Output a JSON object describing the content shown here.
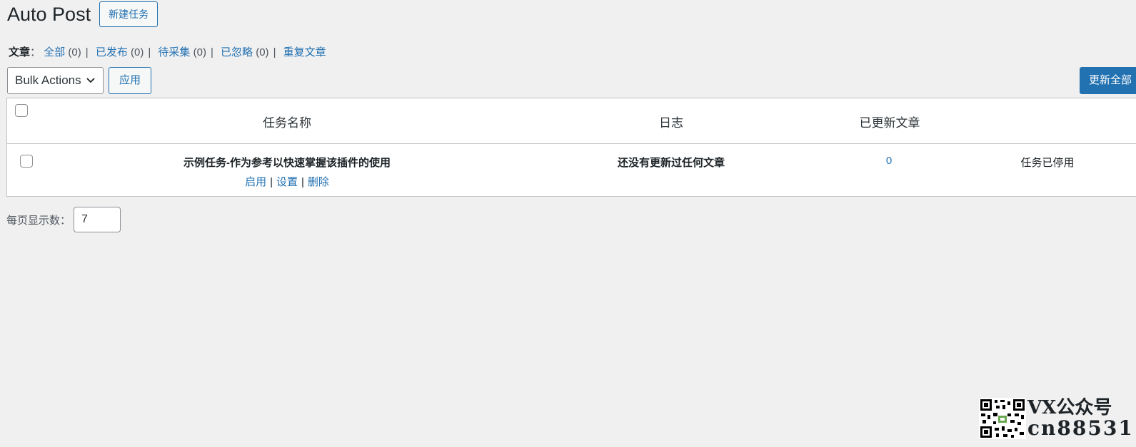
{
  "header": {
    "title": "Auto Post",
    "new_task_label": "新建任务"
  },
  "filters": {
    "label": "文章",
    "colon": "：",
    "items": [
      {
        "label": "全部",
        "count": "(0)"
      },
      {
        "label": "已发布",
        "count": "(0)"
      },
      {
        "label": "待采集",
        "count": "(0)"
      },
      {
        "label": "已忽略",
        "count": "(0)"
      },
      {
        "label": "重复文章",
        "count": ""
      }
    ],
    "separator": "|"
  },
  "tablenav": {
    "bulk_actions": "Bulk Actions",
    "apply_label": "应用",
    "update_all_label": "更新全部"
  },
  "table": {
    "columns": [
      "任务名称",
      "日志",
      "已更新文章"
    ],
    "rows": [
      {
        "name": "示例任务-作为参考以快速掌握该插件的使用",
        "actions": [
          "启用",
          "设置",
          "删除"
        ],
        "log": "还没有更新过任何文章",
        "updated_count": "0",
        "status": "任务已停用"
      }
    ]
  },
  "pagination": {
    "per_page_label": "每页显示数：",
    "per_page_value": "7"
  },
  "watermark": {
    "line1": "VX公众号",
    "line2": "cn88531"
  },
  "colors": {
    "accent": "#2271b1",
    "background": "#f0f0f1",
    "border": "#c3c4c7"
  },
  "icons": {
    "select_chevron": "chevron-down-icon",
    "watermark_qr": "qr-code-icon"
  }
}
